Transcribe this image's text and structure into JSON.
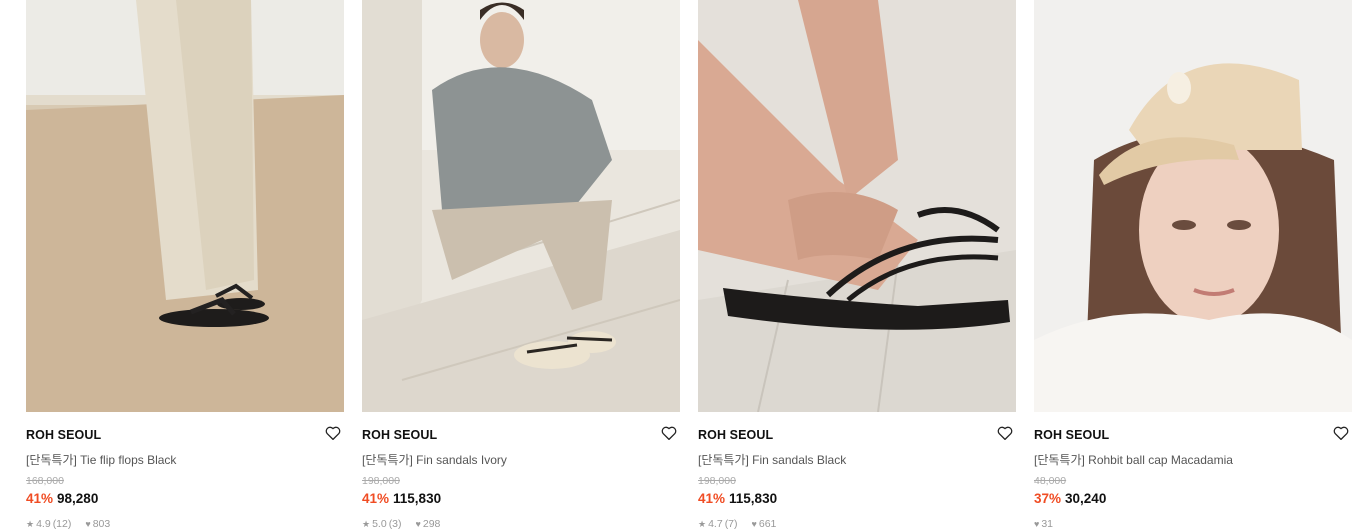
{
  "products": [
    {
      "brand": "ROH SEOUL",
      "name": "[단독특가] Tie flip flops Black",
      "original_price": "168,000",
      "discount": "41%",
      "price": "98,280",
      "rating": "4.9",
      "reviews": "(12)",
      "likes": "803",
      "image_icon": "tie-flip-flops-photo"
    },
    {
      "brand": "ROH SEOUL",
      "name": "[단독특가] Fin sandals Ivory",
      "original_price": "198,000",
      "discount": "41%",
      "price": "115,830",
      "rating": "5.0",
      "reviews": "(3)",
      "likes": "298",
      "image_icon": "fin-sandals-ivory-photo"
    },
    {
      "brand": "ROH SEOUL",
      "name": "[단독특가] Fin sandals Black",
      "original_price": "198,000",
      "discount": "41%",
      "price": "115,830",
      "rating": "4.7",
      "reviews": "(7)",
      "likes": "661",
      "image_icon": "fin-sandals-black-photo"
    },
    {
      "brand": "ROH SEOUL",
      "name": "[단독특가] Rohbit ball cap Macadamia",
      "original_price": "48,000",
      "discount": "37%",
      "price": "30,240",
      "likes": "31",
      "image_icon": "ball-cap-photo"
    }
  ],
  "colors": {
    "discount": "#f04c23",
    "text": "#111111",
    "muted": "#999999"
  }
}
